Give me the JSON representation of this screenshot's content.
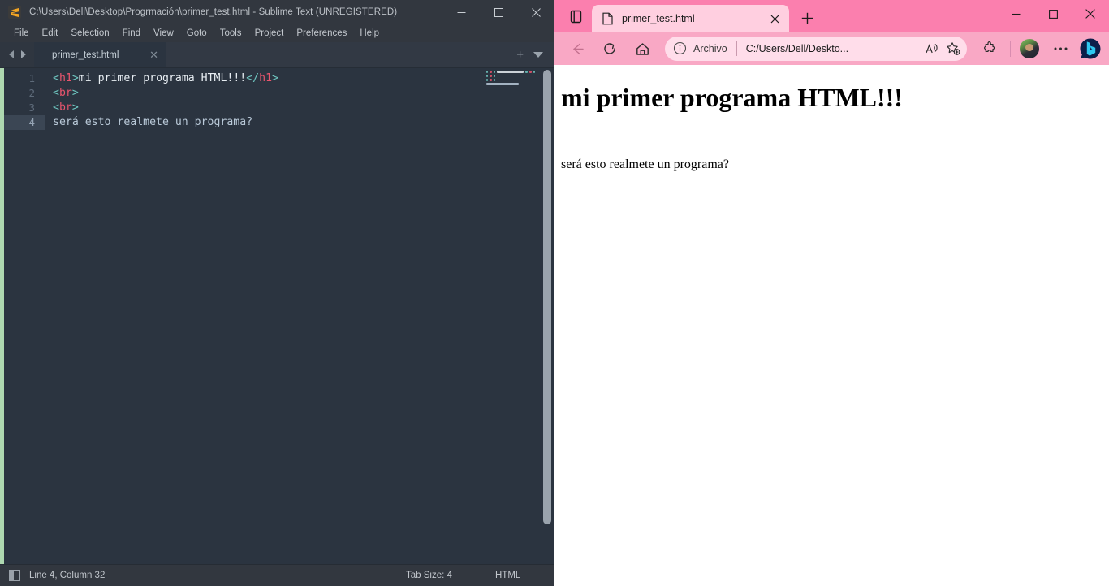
{
  "sublime": {
    "window_title": "C:\\Users\\Dell\\Desktop\\Progrmación\\primer_test.html - Sublime Text (UNREGISTERED)",
    "app_icon": "sublime-logo-icon",
    "window_controls": {
      "minimize": "—",
      "maximize": "▢",
      "close": "✕"
    },
    "menu": [
      "File",
      "Edit",
      "Selection",
      "Find",
      "View",
      "Goto",
      "Tools",
      "Project",
      "Preferences",
      "Help"
    ],
    "tab": {
      "label": "primer_test.html",
      "close": "✕"
    },
    "tabbar_right": {
      "new_tab": "+",
      "dropdown": "▾"
    },
    "gutter": [
      "1",
      "2",
      "3",
      "4"
    ],
    "active_line": 4,
    "code_lines": [
      [
        {
          "t": "<",
          "c": "punct"
        },
        {
          "t": "h1",
          "c": "tag"
        },
        {
          "t": ">",
          "c": "punct"
        },
        {
          "t": "mi primer programa HTML!!!",
          "c": "text"
        },
        {
          "t": "</",
          "c": "punct"
        },
        {
          "t": "h1",
          "c": "tag"
        },
        {
          "t": ">",
          "c": "punct"
        }
      ],
      [
        {
          "t": "<",
          "c": "punct"
        },
        {
          "t": "br",
          "c": "tag"
        },
        {
          "t": ">",
          "c": "punct"
        }
      ],
      [
        {
          "t": "<",
          "c": "punct"
        },
        {
          "t": "br",
          "c": "tag"
        },
        {
          "t": ">",
          "c": "punct"
        }
      ],
      [
        {
          "t": "será esto realmete un programa?",
          "c": "plain"
        }
      ]
    ],
    "status": {
      "cursor": "Line 4, Column 32",
      "tab_size": "Tab Size: 4",
      "syntax": "HTML"
    },
    "colors": {
      "bg": "#2b3440",
      "chrome": "#32373f",
      "punct": "#6fc6c0",
      "tag": "#e8556d",
      "text": "#e7edf2",
      "plain": "#b9c9d8",
      "left_strip": "#aed8b0",
      "logo": "#f5a623"
    }
  },
  "edge": {
    "theme_color": "#fb7fae",
    "toolbar_color": "#f9a8c5",
    "tab_color": "#ffcfe0",
    "omnibox_color": "#ffddea",
    "tab_search_icon": "tab-search-icon",
    "tab": {
      "favicon": "page-file-icon",
      "title": "primer_test.html",
      "close": "✕"
    },
    "new_tab_label": "+",
    "window_controls": {
      "minimize": "—",
      "maximize": "▢",
      "close": "✕"
    },
    "toolbar": {
      "back_icon": "back-arrow-icon",
      "refresh_icon": "refresh-icon",
      "home_icon": "home-icon",
      "info_icon": "info-circle-icon",
      "scheme_label": "Archivo",
      "url": "C:/Users/Dell/Deskto...",
      "read_aloud_icon": "read-aloud-icon",
      "favorite_icon": "add-favorite-star-icon",
      "extensions_icon": "extensions-puzzle-icon",
      "profile_icon": "profile-avatar",
      "settings_icon": "more-settings-icon",
      "copilot_icon": "bing-copilot-icon"
    },
    "page": {
      "heading": "mi primer programa HTML!!!",
      "paragraph": "será esto realmete un programa?"
    }
  }
}
